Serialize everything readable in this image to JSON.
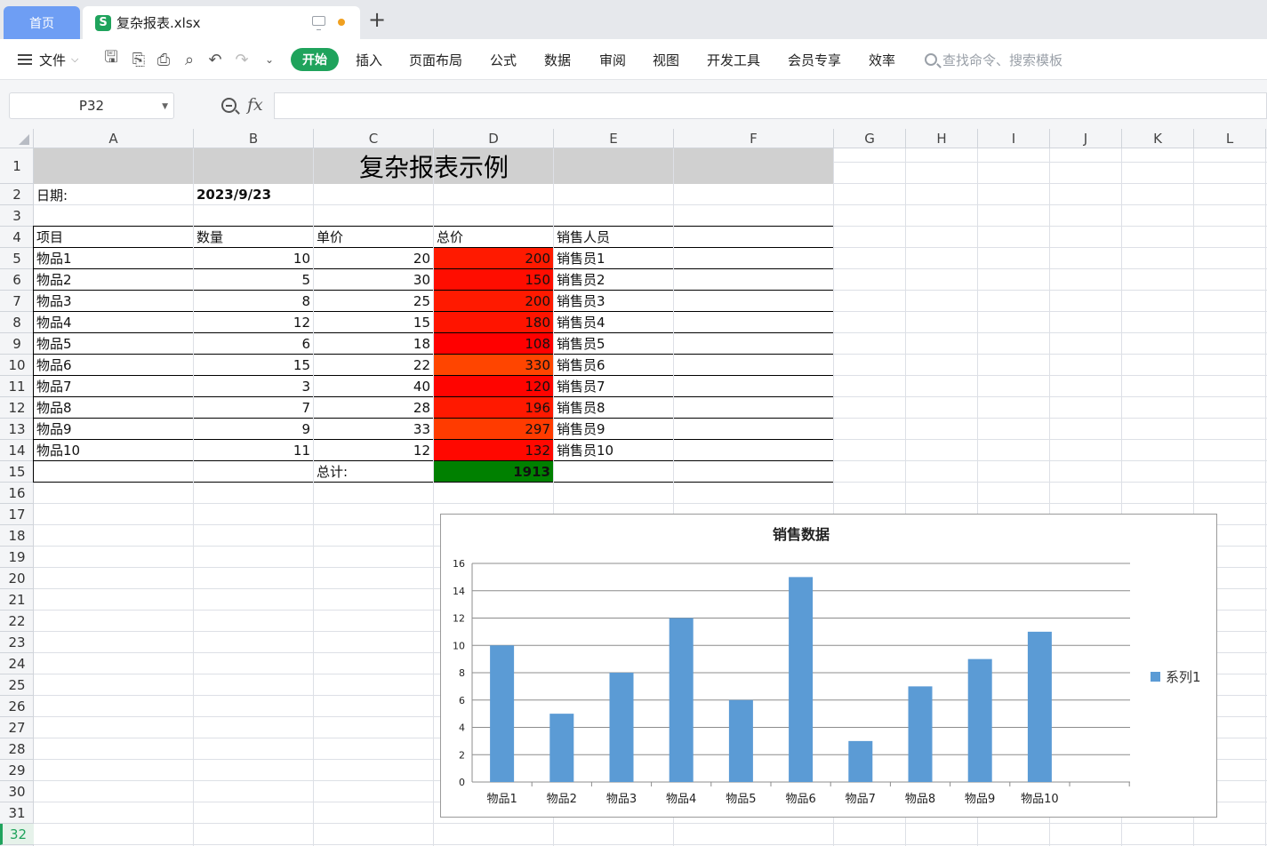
{
  "tabs": {
    "home": "首页",
    "file": "复杂报表.xlsx"
  },
  "ribbon": {
    "file_menu": "文件",
    "tabs": [
      "开始",
      "插入",
      "页面布局",
      "公式",
      "数据",
      "审阅",
      "视图",
      "开发工具",
      "会员专享",
      "效率"
    ],
    "search_placeholder": "查找命令、搜索模板"
  },
  "formula_bar": {
    "name_box": "P32",
    "formula": ""
  },
  "columns": [
    "A",
    "B",
    "C",
    "D",
    "E",
    "F",
    "G",
    "H",
    "I",
    "J",
    "K",
    "L"
  ],
  "rows": [
    "1",
    "2",
    "3",
    "4",
    "5",
    "6",
    "7",
    "8",
    "9",
    "10",
    "11",
    "12",
    "13",
    "14",
    "15",
    "16",
    "17",
    "18",
    "19",
    "20",
    "21",
    "22",
    "23",
    "24",
    "25",
    "26",
    "27",
    "28",
    "29",
    "30",
    "31",
    "32"
  ],
  "active_row": "32",
  "sheet": {
    "title": "复杂报表示例",
    "date_label": "日期:",
    "date_value": "2023/9/23",
    "headers": [
      "项目",
      "数量",
      "单价",
      "总价",
      "销售人员"
    ],
    "items": [
      {
        "name": "物品1",
        "qty": "10",
        "price": "20",
        "total": "200",
        "seller": "销售员1",
        "color": "#ff1a00"
      },
      {
        "name": "物品2",
        "qty": "5",
        "price": "30",
        "total": "150",
        "seller": "销售员2",
        "color": "#ff0d00"
      },
      {
        "name": "物品3",
        "qty": "8",
        "price": "25",
        "total": "200",
        "seller": "销售员3",
        "color": "#ff1a00"
      },
      {
        "name": "物品4",
        "qty": "12",
        "price": "15",
        "total": "180",
        "seller": "销售员4",
        "color": "#ff1400"
      },
      {
        "name": "物品5",
        "qty": "6",
        "price": "18",
        "total": "108",
        "seller": "销售员5",
        "color": "#ff0000"
      },
      {
        "name": "物品6",
        "qty": "15",
        "price": "22",
        "total": "330",
        "seller": "销售员6",
        "color": "#ff4500"
      },
      {
        "name": "物品7",
        "qty": "3",
        "price": "40",
        "total": "120",
        "seller": "销售员7",
        "color": "#ff0400"
      },
      {
        "name": "物品8",
        "qty": "7",
        "price": "28",
        "total": "196",
        "seller": "销售员8",
        "color": "#ff1900"
      },
      {
        "name": "物品9",
        "qty": "9",
        "price": "33",
        "total": "297",
        "seller": "销售员9",
        "color": "#ff3b00"
      },
      {
        "name": "物品10",
        "qty": "11",
        "price": "12",
        "total": "132",
        "seller": "销售员10",
        "color": "#ff0800"
      }
    ],
    "total_label": "总计:",
    "total_value": "1913",
    "total_color": "#008000"
  },
  "chart_data": {
    "type": "bar",
    "title": "销售数据",
    "categories": [
      "物品1",
      "物品2",
      "物品3",
      "物品4",
      "物品5",
      "物品6",
      "物品7",
      "物品8",
      "物品9",
      "物品10"
    ],
    "series": [
      {
        "name": "系列1",
        "values": [
          10,
          5,
          8,
          12,
          6,
          15,
          3,
          7,
          9,
          11
        ],
        "color": "#5b9bd5"
      }
    ],
    "ylim": [
      0,
      16
    ],
    "yticks": [
      "0",
      "2",
      "4",
      "6",
      "8",
      "10",
      "12",
      "14",
      "16"
    ],
    "grid": true,
    "legend": "right"
  }
}
